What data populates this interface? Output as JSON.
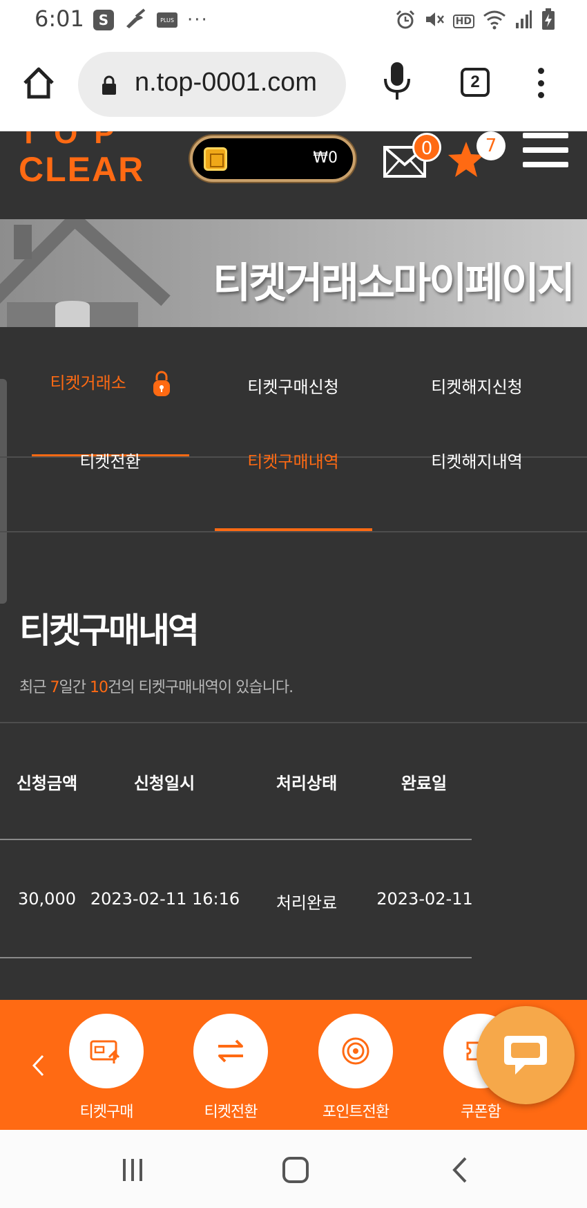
{
  "status_bar": {
    "time": "6:01",
    "left_icons": [
      "s-app-icon",
      "broom-icon",
      "plus-app-icon",
      "more-dots-icon"
    ],
    "plus_label": "PLUS",
    "right_icons": [
      "alarm-icon",
      "mute-icon",
      "hd-icon",
      "wifi-icon",
      "signal-icon",
      "battery-charging-icon"
    ],
    "hd_label": "HD"
  },
  "browser": {
    "url": "n.top-0001.com",
    "tab_count": "2"
  },
  "header": {
    "logo_top": "TOP",
    "logo": "CLEAR",
    "wallet_amount": "₩0",
    "mail_badge": "0",
    "star_badge": "7"
  },
  "banner": {
    "title": "티켓거래소마이페이지"
  },
  "tabs": {
    "row1": [
      "티켓거래소",
      "티켓구매신청",
      "티켓해지신청"
    ],
    "row2": [
      "티켓전환",
      "티켓구매내역",
      "티켓해지내역"
    ]
  },
  "content": {
    "heading": "티켓구매내역",
    "summary_prefix": "최근 ",
    "summary_days": "7",
    "summary_mid": "일간 ",
    "summary_count": "10",
    "summary_suffix": "건의 티켓구매내역이 있습니다."
  },
  "table": {
    "headers": [
      "신청금액",
      "신청일시",
      "처리상태",
      "완료일"
    ],
    "rows": [
      [
        "30,000",
        "2023-02-11 16:16",
        "처리완료",
        "2023-02-11"
      ]
    ]
  },
  "quick_menu": {
    "items": [
      "티켓구매",
      "티켓전환",
      "포인트전환",
      "쿠폰함"
    ]
  },
  "colors": {
    "accent": "#ff6a13",
    "background": "#333333",
    "chat": "#f6a84a"
  }
}
